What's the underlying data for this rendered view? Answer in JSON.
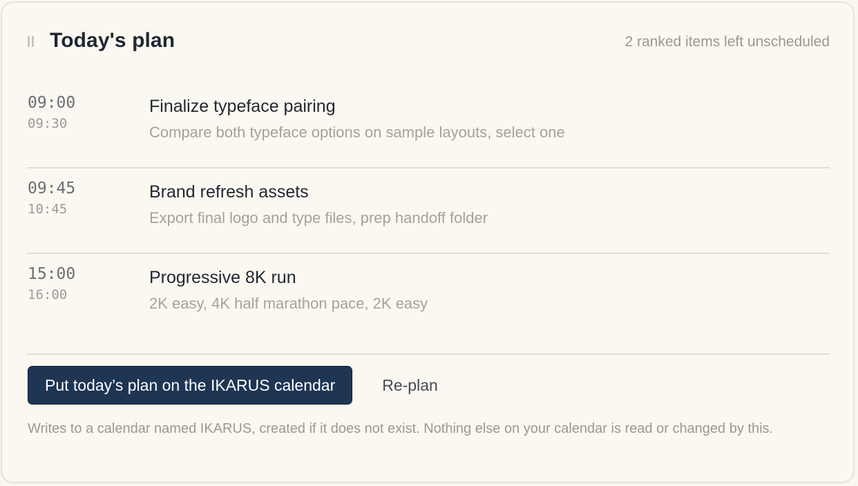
{
  "header": {
    "title": "Today's plan",
    "unscheduled_text": "2 ranked items left unscheduled"
  },
  "items": [
    {
      "start": "09:00",
      "end": "09:30",
      "title": "Finalize typeface pairing",
      "description": "Compare both typeface options on sample layouts, select one"
    },
    {
      "start": "09:45",
      "end": "10:45",
      "title": "Brand refresh assets",
      "description": "Export final logo and type files, prep handoff folder"
    },
    {
      "start": "15:00",
      "end": "16:00",
      "title": "Progressive 8K run",
      "description": "2K easy, 4K half marathon pace, 2K easy"
    }
  ],
  "actions": {
    "primary_label": "Put today’s plan on the IKARUS calendar",
    "secondary_label": "Re-plan"
  },
  "footnote": "Writes to a calendar named IKARUS, created if it does not exist. Nothing else on your calendar is read or changed by this.",
  "colors": {
    "primary_button": "#1e3554",
    "card_background": "#faf8f1"
  },
  "icons": {
    "handle": "drag-handle-icon"
  }
}
